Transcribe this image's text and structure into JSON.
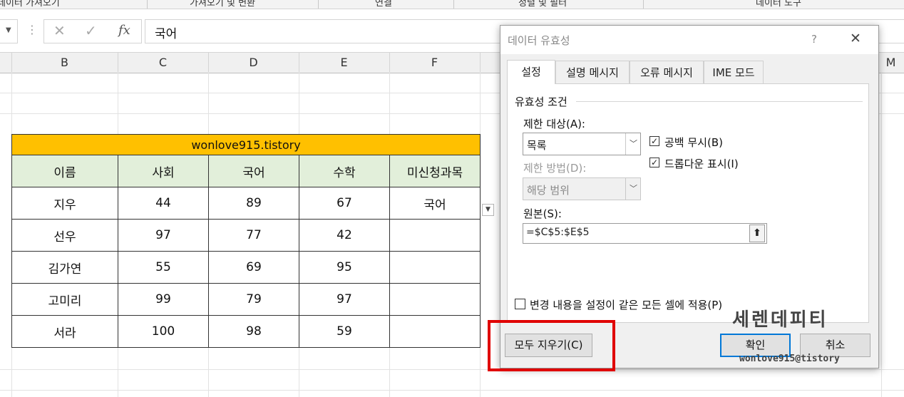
{
  "ribbon": {
    "groups": [
      "데이터 가져오기",
      "가져오기 및 변환",
      "연결",
      "정렬 및 필터",
      "데이터 도구"
    ]
  },
  "formula_bar": {
    "cancel_symbol": "✕",
    "enter_symbol": "✓",
    "function_symbol": "fx",
    "content": "국어"
  },
  "columns": [
    "B",
    "C",
    "D",
    "E",
    "F",
    "M"
  ],
  "table": {
    "banner": "wonlove915.tistory",
    "headers": [
      "이름",
      "사회",
      "국어",
      "수학",
      "미신청과목"
    ],
    "rows": [
      [
        "지우",
        "44",
        "89",
        "67",
        "국어"
      ],
      [
        "선우",
        "97",
        "77",
        "42",
        ""
      ],
      [
        "김가연",
        "55",
        "69",
        "95",
        ""
      ],
      [
        "고미리",
        "99",
        "79",
        "97",
        ""
      ],
      [
        "서라",
        "100",
        "98",
        "59",
        ""
      ]
    ]
  },
  "dialog": {
    "title": "데이터 유효성",
    "help": "?",
    "close": "✕",
    "tabs": [
      "설정",
      "설명 메시지",
      "오류 메시지",
      "IME 모드"
    ],
    "section_title": "유효성 조건",
    "allow_label": "제한 대상(A):",
    "allow_value": "목록",
    "data_label": "제한 방법(D):",
    "data_value": "해당 범위",
    "ignore_blank": "공백 무시(B)",
    "in_cell_dropdown": "드롭다운 표시(I)",
    "source_label": "원본(S):",
    "source_value": "=$C$5:$E$5",
    "apply_all": "변경 내용을 설정이 같은 모든 셀에 적용(P)",
    "clear_all": "모두 지우기(C)",
    "ok": "확인",
    "cancel": "취소"
  },
  "watermark": {
    "title": "세렌데피티",
    "subtitle": "wonlove915@tistory"
  },
  "colors": {
    "banner": "#ffc000",
    "header_fill": "#e2efda",
    "highlight": "#e00000",
    "ok_border": "#0078d7"
  }
}
